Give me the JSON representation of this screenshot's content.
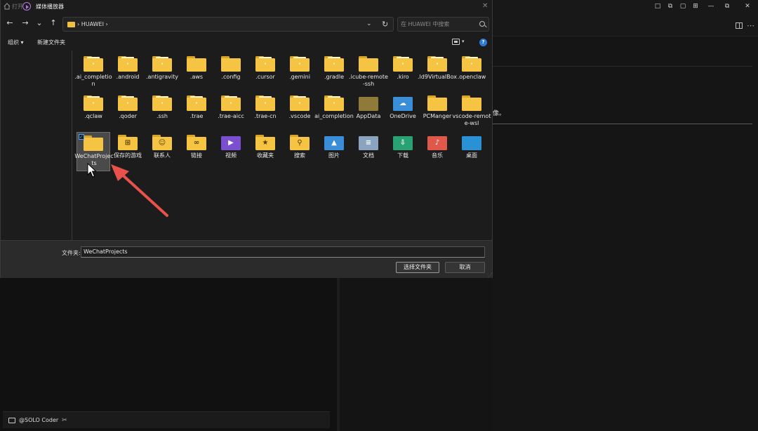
{
  "background": {
    "notice_tail": "像。",
    "solo_coder_label": "@SOLO Coder",
    "window_controls": [
      "□",
      "⧉",
      "▢",
      "⊞",
      "—",
      "⧉",
      "✕"
    ]
  },
  "dialog": {
    "titlebar": {
      "open_label": "打开",
      "app_title": "媒体播放器",
      "close_glyph": "✕"
    },
    "nav": {
      "back": "←",
      "forward": "→",
      "history": "⌄",
      "up": "↑",
      "breadcrumb": "› HUAWEI ›",
      "address_dropdown": "⌄",
      "refresh": "↻",
      "search_placeholder": "在 HUAWEI 中搜索"
    },
    "toolbar": {
      "organize": "组织 ▾",
      "new_folder": "新建文件夹",
      "view_dropdown": "▾",
      "help": "?"
    },
    "folders": [
      {
        "name": ".ai_completion",
        "kind": "paper"
      },
      {
        "name": ".android",
        "kind": "paper"
      },
      {
        "name": ".antigravity",
        "kind": "paper"
      },
      {
        "name": ".aws",
        "kind": "plain"
      },
      {
        "name": ".config",
        "kind": "plain"
      },
      {
        "name": ".cursor",
        "kind": "paper"
      },
      {
        "name": ".gemini",
        "kind": "paper"
      },
      {
        "name": ".gradle",
        "kind": "paper"
      },
      {
        "name": ".icube-remote-ssh",
        "kind": "plain"
      },
      {
        "name": ".kiro",
        "kind": "paper"
      },
      {
        "name": ".ld9VirtualBox",
        "kind": "paper"
      },
      {
        "name": ".openclaw",
        "kind": "paper"
      },
      {
        "name": ".qclaw",
        "kind": "paper"
      },
      {
        "name": ".qoder",
        "kind": "paper"
      },
      {
        "name": ".ssh",
        "kind": "paper"
      },
      {
        "name": ".trae",
        "kind": "paper"
      },
      {
        "name": ".trae-aicc",
        "kind": "paper"
      },
      {
        "name": ".trae-cn",
        "kind": "paper"
      },
      {
        "name": ".vscode",
        "kind": "paper"
      },
      {
        "name": "ai_completion",
        "kind": "paper"
      },
      {
        "name": "AppData",
        "kind": "appdata"
      },
      {
        "name": "OneDrive",
        "kind": "onedrive"
      },
      {
        "name": "PCManger",
        "kind": "plain"
      },
      {
        "name": "vscode-remote-wsl",
        "kind": "plain"
      },
      {
        "name": "WeChatProjects",
        "kind": "plain",
        "selected": true
      },
      {
        "name": "保存的游戏",
        "kind": "games"
      },
      {
        "name": "联系人",
        "kind": "contacts"
      },
      {
        "name": "链接",
        "kind": "links"
      },
      {
        "name": "视频",
        "kind": "videos"
      },
      {
        "name": "收藏夹",
        "kind": "favorites"
      },
      {
        "name": "搜索",
        "kind": "search"
      },
      {
        "name": "图片",
        "kind": "pictures"
      },
      {
        "name": "文档",
        "kind": "documents"
      },
      {
        "name": "下载",
        "kind": "downloads"
      },
      {
        "name": "音乐",
        "kind": "music"
      },
      {
        "name": "桌面",
        "kind": "desktop"
      }
    ],
    "folder_field": {
      "label": "文件夹:",
      "value": "WeChatProjects"
    },
    "buttons": {
      "select_folder": "选择文件夹",
      "cancel": "取消"
    }
  },
  "colors": {
    "folder": "#f6c443",
    "folder_back": "#d9a528",
    "accent_blue": "#2e7ad6",
    "annotation_arrow": "#e8524a"
  }
}
